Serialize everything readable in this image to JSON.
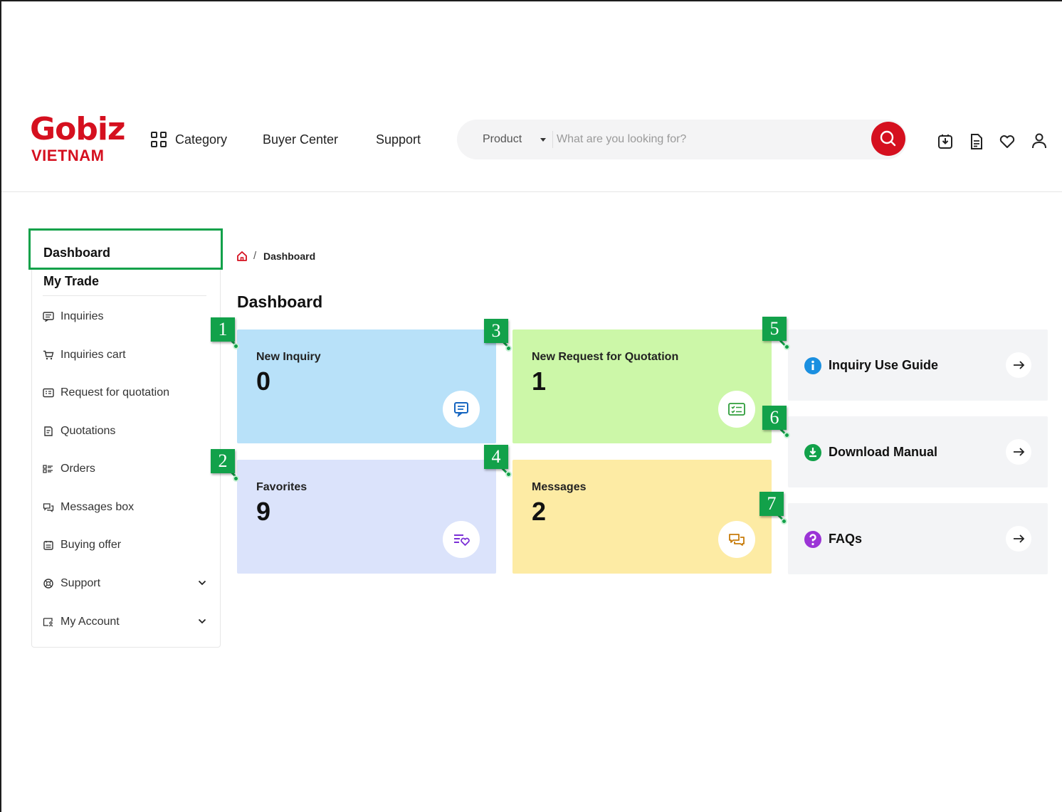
{
  "header": {
    "logo_top": "Gobiz",
    "logo_bottom": "VIETNAM",
    "nav": [
      "Category",
      "Buyer Center",
      "Support"
    ],
    "search": {
      "scope": "Product",
      "placeholder": "What are you looking for?"
    },
    "icons": [
      "download-icon",
      "document-icon",
      "heart-icon",
      "user-icon"
    ]
  },
  "sidebar": {
    "dashboard": "Dashboard",
    "section": "My Trade",
    "items": [
      {
        "label": "Inquiries",
        "icon": "inquiry-icon"
      },
      {
        "label": "Inquiries cart",
        "icon": "cart-icon"
      },
      {
        "label": "Request for quotation",
        "icon": "rfq-icon"
      },
      {
        "label": "Quotations",
        "icon": "quotation-icon"
      },
      {
        "label": "Orders",
        "icon": "orders-icon"
      },
      {
        "label": "Messages box",
        "icon": "messages-icon"
      },
      {
        "label": "Buying offer",
        "icon": "buying-offer-icon"
      },
      {
        "label": "Support",
        "icon": "support-icon",
        "expandable": true
      },
      {
        "label": "My Account",
        "icon": "account-icon",
        "expandable": true
      }
    ]
  },
  "breadcrumb": {
    "current": "Dashboard"
  },
  "main": {
    "title": "Dashboard",
    "cards": [
      {
        "title": "New Inquiry",
        "value": "0",
        "color": "#b8e1f9",
        "icon": "inquiry-icon"
      },
      {
        "title": "New Request for Quotation",
        "value": "1",
        "color": "#ccf7a8",
        "icon": "rfq-icon"
      },
      {
        "title": "Favorites",
        "value": "9",
        "color": "#dbe3fb",
        "icon": "favorites-icon"
      },
      {
        "title": "Messages",
        "value": "2",
        "color": "#fdeba4",
        "icon": "messages-icon"
      }
    ],
    "links": [
      {
        "title": "Inquiry Use Guide",
        "icon": "info-icon",
        "color": "#1a8fe0"
      },
      {
        "title": "Download Manual",
        "icon": "download-icon",
        "color": "#12a14a"
      },
      {
        "title": "FAQs",
        "icon": "question-icon",
        "color": "#9b34d6"
      }
    ]
  },
  "annotations": [
    "1",
    "2",
    "3",
    "4",
    "5",
    "6",
    "7"
  ],
  "colors": {
    "brand": "#d5101f",
    "highlight": "#12a14a"
  }
}
